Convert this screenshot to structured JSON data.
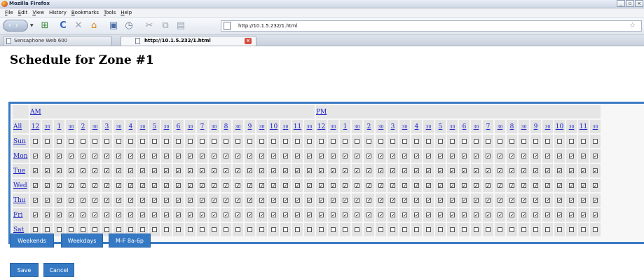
{
  "window": {
    "title": "Mozilla Firefox"
  },
  "menu": {
    "items": [
      {
        "first": "F",
        "rest": "ile"
      },
      {
        "first": "E",
        "rest": "dit"
      },
      {
        "first": "V",
        "rest": "iew"
      },
      {
        "first": "",
        "rest": "History"
      },
      {
        "first": "B",
        "rest": "ookmarks"
      },
      {
        "first": "T",
        "rest": "ools"
      },
      {
        "first": "H",
        "rest": "elp"
      }
    ]
  },
  "nav": {
    "url": "http://10.1.5.232/1.html"
  },
  "tabs": [
    {
      "label": "Sensaphone Web 600"
    },
    {
      "label": "http://10.1.5.232/1.html"
    }
  ],
  "page": {
    "title": "Schedule for Zone #1"
  },
  "schedule": {
    "am_label": "AM",
    "pm_label": "PM",
    "all_label": "All",
    "hours_am": [
      "12",
      "1",
      "2",
      "3",
      "4",
      "5",
      "6",
      "7",
      "8",
      "9",
      "10",
      "11"
    ],
    "hours_pm": [
      "12",
      "1",
      "2",
      "3",
      "4",
      "5",
      "6",
      "7",
      "8",
      "9",
      "10",
      "11"
    ],
    "half_label": "30",
    "days": [
      {
        "label": "Sun",
        "checked": false
      },
      {
        "label": "Mon",
        "checked": true
      },
      {
        "label": "Tue",
        "checked": true
      },
      {
        "label": "Wed",
        "checked": true
      },
      {
        "label": "Thu",
        "checked": true
      },
      {
        "label": "Fri",
        "checked": true
      },
      {
        "label": "Sat",
        "checked": false
      }
    ]
  },
  "buttons": {
    "weekends": "Weekends",
    "weekdays": "Weekdays",
    "mf": "M-F 8a-6p",
    "save": "Save",
    "cancel": "Cancel"
  },
  "colors": {
    "accent": "#3579c4",
    "link": "#1a23c8"
  }
}
